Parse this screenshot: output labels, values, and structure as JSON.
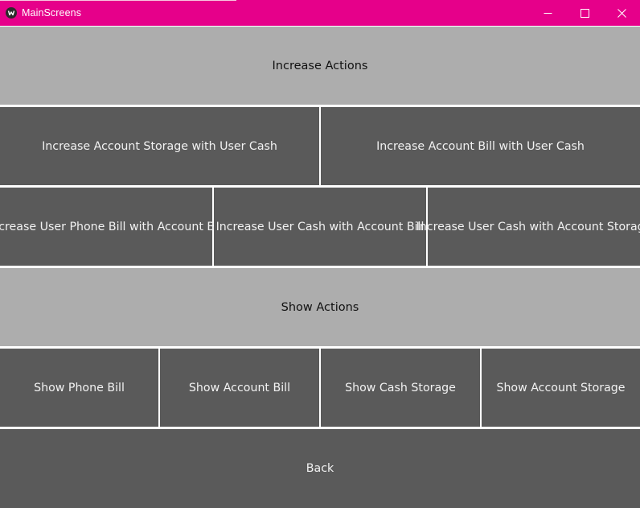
{
  "window": {
    "title": "MainScreens",
    "title_bar_color": "#e6008a",
    "controls": {
      "minimize_icon": "minimize-icon",
      "maximize_icon": "maximize-icon",
      "close_icon": "close-icon"
    }
  },
  "colors": {
    "header_button_bg": "#adadad",
    "action_button_bg": "#5a5a5a",
    "action_button_text": "#f2f2f2"
  },
  "sections": {
    "increase": {
      "header": "Increase Actions",
      "row1": [
        "Increase Account Storage with User Cash",
        "Increase Account Bill with User Cash"
      ],
      "row2": [
        "Increase User Phone Bill with Account Bill",
        "Increase User Cash with Account Bill",
        "Increase User Cash with Account Storage"
      ]
    },
    "show": {
      "header": "Show Actions",
      "buttons": [
        "Show Phone Bill",
        "Show Account Bill",
        "Show Cash Storage",
        "Show Account Storage"
      ]
    },
    "back_label": "Back"
  }
}
